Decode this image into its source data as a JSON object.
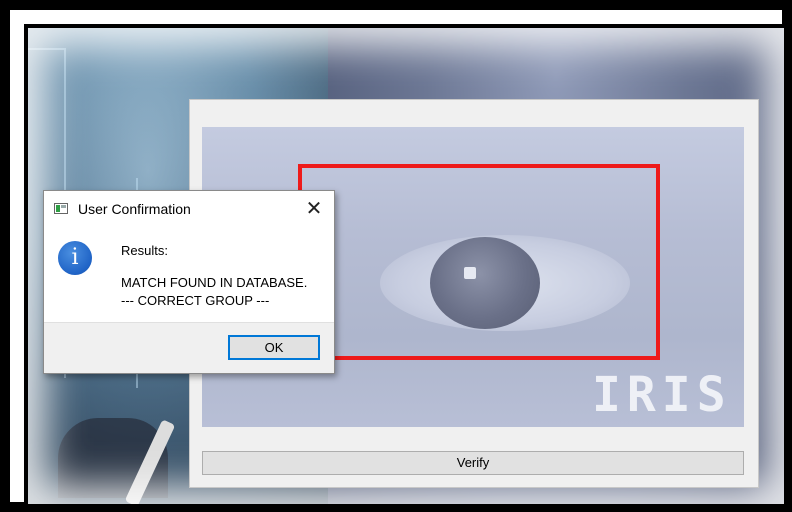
{
  "dialog": {
    "title": "User Confirmation",
    "close_symbol": "✕",
    "icon": "info-icon",
    "icon_glyph": "i",
    "message_header": "Results:",
    "message_line1": "MATCH FOUND IN DATABASE.",
    "message_line2": "--- CORRECT GROUP ---",
    "ok_label": "OK"
  },
  "scanner": {
    "overlay_text": "IRIS",
    "verify_label": "Verify",
    "detection_box_color": "#ee1a1a"
  },
  "colors": {
    "accent": "#0078d7",
    "info_icon": "#1f63c6"
  }
}
